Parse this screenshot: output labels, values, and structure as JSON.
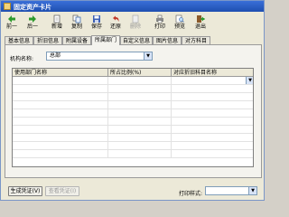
{
  "window": {
    "title": "固定资产卡片"
  },
  "toolbar": {
    "items": [
      {
        "label": "前一",
        "icon": "arrow-left-icon"
      },
      {
        "label": "后一",
        "icon": "arrow-right-icon"
      },
      {
        "label": "新增",
        "icon": "new-document-icon"
      },
      {
        "label": "复制",
        "icon": "copy-icon"
      },
      {
        "label": "保存",
        "icon": "save-icon"
      },
      {
        "label": "还原",
        "icon": "undo-icon"
      },
      {
        "label": "删除",
        "icon": "delete-icon",
        "disabled": true
      },
      {
        "label": "打印",
        "icon": "print-icon"
      },
      {
        "label": "预览",
        "icon": "preview-icon"
      },
      {
        "label": "退出",
        "icon": "exit-icon"
      }
    ]
  },
  "tabs": [
    "基本信息",
    "折旧信息",
    "附属设备",
    "所属部门",
    "自定义信息",
    "图片信息",
    "对方科目"
  ],
  "active_tab": "所属部门",
  "form": {
    "org_label": "机构名称:",
    "org_value": "总部"
  },
  "grid": {
    "columns": [
      "使用部门名称",
      "所占比例(%)",
      "对应折旧科目名称"
    ],
    "rows": [
      [
        "",
        "",
        ""
      ],
      [
        "",
        "",
        ""
      ],
      [
        "",
        "",
        ""
      ],
      [
        "",
        "",
        ""
      ],
      [
        "",
        "",
        ""
      ],
      [
        "",
        "",
        ""
      ],
      [
        "",
        "",
        ""
      ],
      [
        "",
        "",
        ""
      ],
      [
        "",
        "",
        ""
      ],
      [
        "",
        "",
        ""
      ]
    ]
  },
  "bottom": {
    "generate_voucher": "生成凭证(V)",
    "view_voucher": "查看凭证(I)",
    "print_style_label": "打印样式:",
    "print_style_value": ""
  },
  "colors": {
    "title_bar": "#1e4fb0",
    "panel_bg": "#f4f3ee"
  }
}
